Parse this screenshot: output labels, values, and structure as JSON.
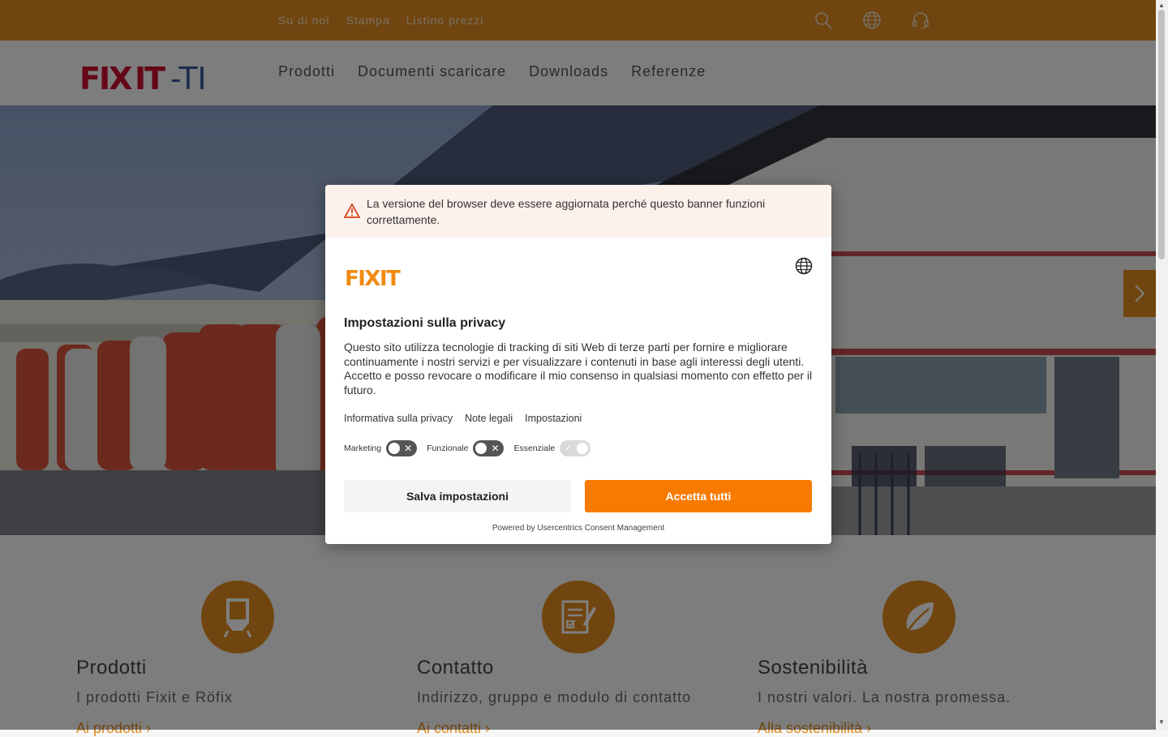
{
  "topbar": {
    "links": [
      "Su di noi",
      "Stampa",
      "Listino prezzi"
    ],
    "icons": [
      "search-icon",
      "globe-icon",
      "headset-icon"
    ],
    "color": "#e08a1e"
  },
  "header": {
    "logo_text": "FIXIT-TI",
    "nav": [
      "Prodotti",
      "Documenti scaricare",
      "Downloads",
      "Referenze"
    ]
  },
  "hero": {
    "next_icon": "chevron-right-icon"
  },
  "cards": [
    {
      "title": "Prodotti",
      "subtitle": "I prodotti Fixit e Röfix",
      "link": "Ai prodotti ›",
      "icon": "silo-icon"
    },
    {
      "title": "Contatto",
      "subtitle": "Indirizzo, gruppo e modulo di contatto",
      "link": "Ai contatti ›",
      "icon": "document-edit-icon"
    },
    {
      "title": "Sostenibilità",
      "subtitle": "I nostri valori. La nostra promessa.",
      "link": "Alla sostenibilità ›",
      "icon": "leaf-icon"
    }
  ],
  "consent": {
    "warning": "La versione del browser deve essere aggiornata perché questo banner funzioni correttamente.",
    "logo_text": "FIXIT",
    "title": "Impostazioni sulla privacy",
    "description": "Questo sito utilizza tecnologie di tracking di siti Web di terze parti per fornire e migliorare continuamente i nostri servizi e per visualizzare i contenuti in base agli interessi degli utenti. Accetto e posso revocare o modificare il mio consenso in qualsiasi momento con effetto per il futuro.",
    "links": [
      "Informativa sulla privacy",
      "Note legali",
      "Impostazioni"
    ],
    "toggles": [
      {
        "label": "Marketing",
        "on": false
      },
      {
        "label": "Funzionale",
        "on": false
      },
      {
        "label": "Essenziale",
        "on": true
      }
    ],
    "save_label": "Salva impostazioni",
    "accept_label": "Accetta tutti",
    "powered": "Powered by Usercentrics Consent Management",
    "accent": "#f97a00"
  }
}
